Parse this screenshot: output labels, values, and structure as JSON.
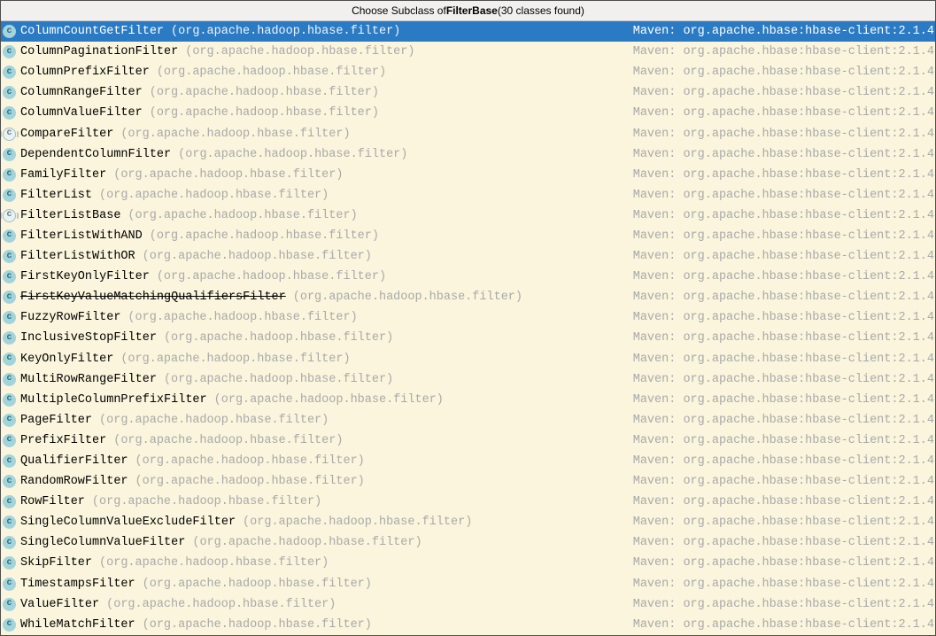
{
  "window": {
    "title_prefix": "Choose Subclass of ",
    "title_target": "FilterBase",
    "title_suffix": " (30 classes found)"
  },
  "colors": {
    "selection_background": "#2b7bc4",
    "list_background": "#faf5dc",
    "title_background": "#f1f0ef",
    "muted_text": "#a9a9a9",
    "class_icon_fill": "#a3d4dc"
  },
  "list": {
    "package": "(org.apache.hadoop.hbase.filter)",
    "maven_label": "Maven: org.apache.hbase:hbase-client:2.1.4",
    "class_icon_glyph": "c",
    "items": [
      {
        "name": "ColumnCountGetFilter",
        "selected": true,
        "abstract": false,
        "deprecated": false
      },
      {
        "name": "ColumnPaginationFilter",
        "selected": false,
        "abstract": false,
        "deprecated": false
      },
      {
        "name": "ColumnPrefixFilter",
        "selected": false,
        "abstract": false,
        "deprecated": false
      },
      {
        "name": "ColumnRangeFilter",
        "selected": false,
        "abstract": false,
        "deprecated": false
      },
      {
        "name": "ColumnValueFilter",
        "selected": false,
        "abstract": false,
        "deprecated": false
      },
      {
        "name": "CompareFilter",
        "selected": false,
        "abstract": true,
        "deprecated": false
      },
      {
        "name": "DependentColumnFilter",
        "selected": false,
        "abstract": false,
        "deprecated": false
      },
      {
        "name": "FamilyFilter",
        "selected": false,
        "abstract": false,
        "deprecated": false
      },
      {
        "name": "FilterList",
        "selected": false,
        "abstract": false,
        "deprecated": false
      },
      {
        "name": "FilterListBase",
        "selected": false,
        "abstract": true,
        "deprecated": false
      },
      {
        "name": "FilterListWithAND",
        "selected": false,
        "abstract": false,
        "deprecated": false
      },
      {
        "name": "FilterListWithOR",
        "selected": false,
        "abstract": false,
        "deprecated": false
      },
      {
        "name": "FirstKeyOnlyFilter",
        "selected": false,
        "abstract": false,
        "deprecated": false
      },
      {
        "name": "FirstKeyValueMatchingQualifiersFilter",
        "selected": false,
        "abstract": false,
        "deprecated": true
      },
      {
        "name": "FuzzyRowFilter",
        "selected": false,
        "abstract": false,
        "deprecated": false
      },
      {
        "name": "InclusiveStopFilter",
        "selected": false,
        "abstract": false,
        "deprecated": false
      },
      {
        "name": "KeyOnlyFilter",
        "selected": false,
        "abstract": false,
        "deprecated": false
      },
      {
        "name": "MultiRowRangeFilter",
        "selected": false,
        "abstract": false,
        "deprecated": false
      },
      {
        "name": "MultipleColumnPrefixFilter",
        "selected": false,
        "abstract": false,
        "deprecated": false
      },
      {
        "name": "PageFilter",
        "selected": false,
        "abstract": false,
        "deprecated": false
      },
      {
        "name": "PrefixFilter",
        "selected": false,
        "abstract": false,
        "deprecated": false
      },
      {
        "name": "QualifierFilter",
        "selected": false,
        "abstract": false,
        "deprecated": false
      },
      {
        "name": "RandomRowFilter",
        "selected": false,
        "abstract": false,
        "deprecated": false
      },
      {
        "name": "RowFilter",
        "selected": false,
        "abstract": false,
        "deprecated": false
      },
      {
        "name": "SingleColumnValueExcludeFilter",
        "selected": false,
        "abstract": false,
        "deprecated": false
      },
      {
        "name": "SingleColumnValueFilter",
        "selected": false,
        "abstract": false,
        "deprecated": false
      },
      {
        "name": "SkipFilter",
        "selected": false,
        "abstract": false,
        "deprecated": false
      },
      {
        "name": "TimestampsFilter",
        "selected": false,
        "abstract": false,
        "deprecated": false
      },
      {
        "name": "ValueFilter",
        "selected": false,
        "abstract": false,
        "deprecated": false
      },
      {
        "name": "WhileMatchFilter",
        "selected": false,
        "abstract": false,
        "deprecated": false
      }
    ]
  }
}
